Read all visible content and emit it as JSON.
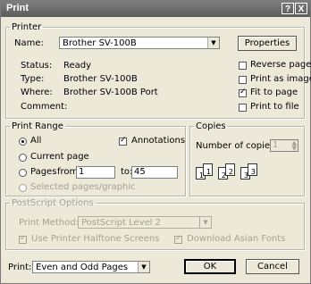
{
  "window": {
    "title": "Print",
    "help_label": "?",
    "close_label": "X"
  },
  "printer": {
    "legend": "Printer",
    "name_label": "Name:",
    "name_value": "Brother SV-100B",
    "properties_label": "Properties",
    "status_label": "Status:",
    "status_value": "Ready",
    "type_label": "Type:",
    "type_value": "Brother SV-100B",
    "where_label": "Where:",
    "where_value": "Brother SV-100B Port",
    "comment_label": "Comment:",
    "options": [
      {
        "label": "Reverse pages",
        "checked": false
      },
      {
        "label": "Print as image",
        "checked": false
      },
      {
        "label": "Fit to page",
        "checked": true
      },
      {
        "label": "Print to file",
        "checked": false
      }
    ]
  },
  "print_range": {
    "legend": "Print Range",
    "all_label": "All",
    "current_page_label": "Current page",
    "pages_label": "Pages",
    "from_label": "from:",
    "from_value": "1",
    "to_label": "to:",
    "to_value": "45",
    "selected_label": "Selected pages/graphic",
    "annotations_label": "Annotations",
    "selected_option": "All",
    "annotations_checked": true
  },
  "copies": {
    "legend": "Copies",
    "number_label": "Number of copies:",
    "number_value": "1",
    "collate_pages": [
      "1",
      "1",
      "2",
      "2",
      "3",
      "3"
    ]
  },
  "postscript": {
    "legend": "PostScript Options",
    "method_label": "Print Method:",
    "method_value": "PostScript Level 2",
    "halftone_label": "Use Printer Halftone Screens",
    "asian_fonts_label": "Download Asian Fonts"
  },
  "footer": {
    "print_label": "Print:",
    "print_value": "Even and Odd Pages",
    "ok_label": "OK",
    "cancel_label": "Cancel"
  }
}
